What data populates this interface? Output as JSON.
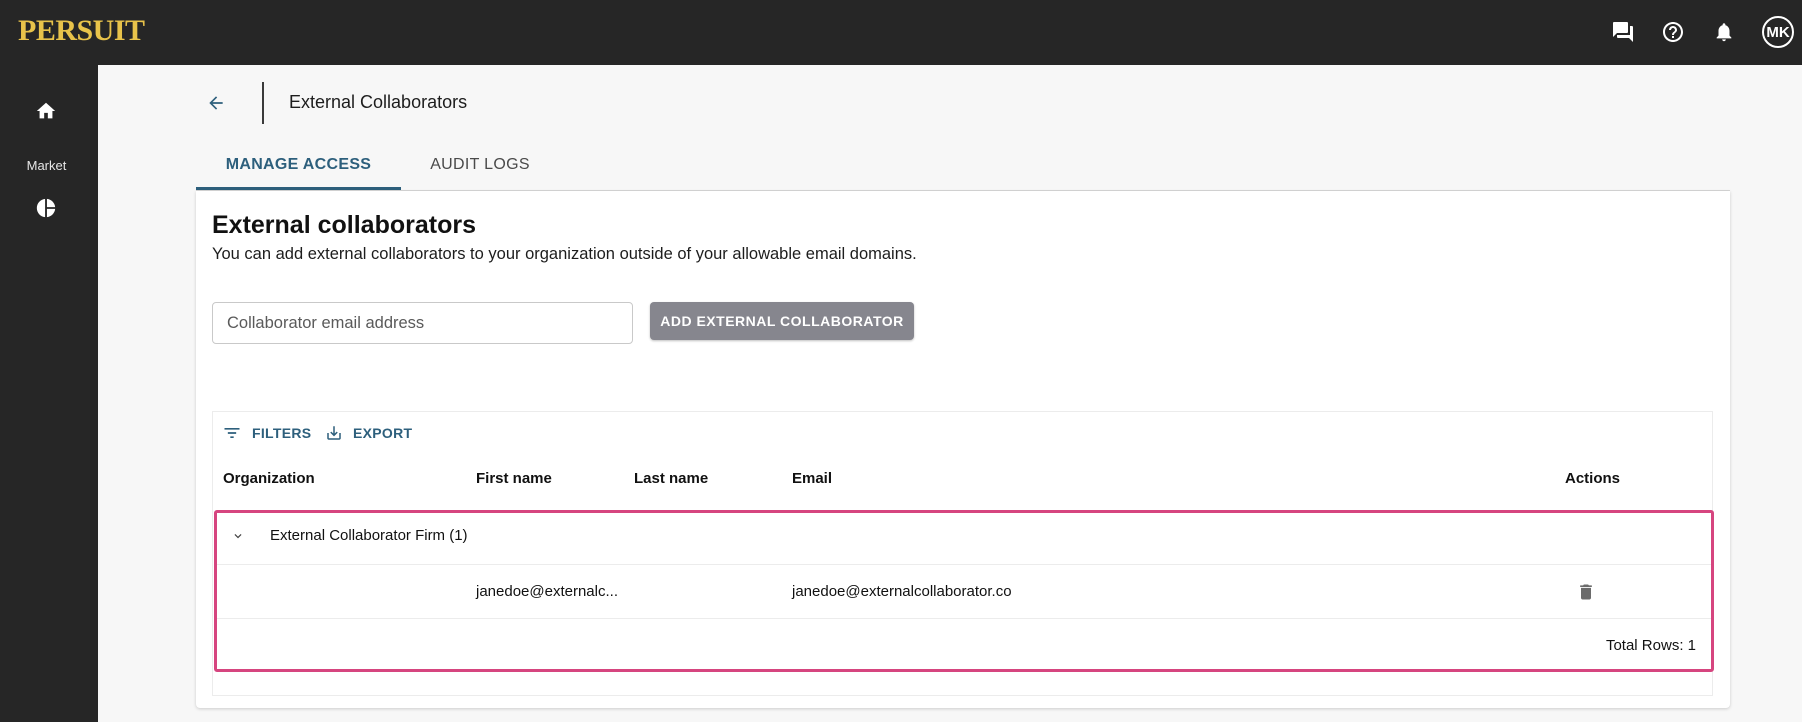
{
  "topbar": {
    "logo": "PERSUIT",
    "icons": [
      "chat-icon",
      "help-icon",
      "bell-icon"
    ],
    "avatar_initials": "MK"
  },
  "sidebar": {
    "items": [
      {
        "icon": "home-icon",
        "label": ""
      },
      {
        "icon": "pie-chart-icon",
        "label": "Market"
      }
    ]
  },
  "header": {
    "title": "External Collaborators"
  },
  "tabs": [
    {
      "label": "MANAGE ACCESS",
      "active": true
    },
    {
      "label": "AUDIT LOGS",
      "active": false
    }
  ],
  "section": {
    "title": "External collaborators",
    "description": "You can add external collaborators to your organization outside of your allowable email domains."
  },
  "form": {
    "email_placeholder": "Collaborator email address",
    "email_value": "",
    "add_button_label": "ADD EXTERNAL COLLABORATOR"
  },
  "table": {
    "toolbar": {
      "filters_label": "FILTERS",
      "export_label": "EXPORT"
    },
    "columns": [
      "Organization",
      "First name",
      "Last name",
      "Email",
      "Actions"
    ],
    "groups": [
      {
        "label": "External Collaborator Firm (1)",
        "rows": [
          {
            "organization": "",
            "first_name": "janedoe@externalc...",
            "last_name": "",
            "email": "janedoe@externalcollaborator.co"
          }
        ]
      }
    ],
    "footer": "Total Rows: 1"
  },
  "colors": {
    "topbar_bg": "#262626",
    "logo": "#e8c34a",
    "accent": "#2d5f7c",
    "button_bg": "#86868e",
    "highlight": "#d6457f"
  }
}
